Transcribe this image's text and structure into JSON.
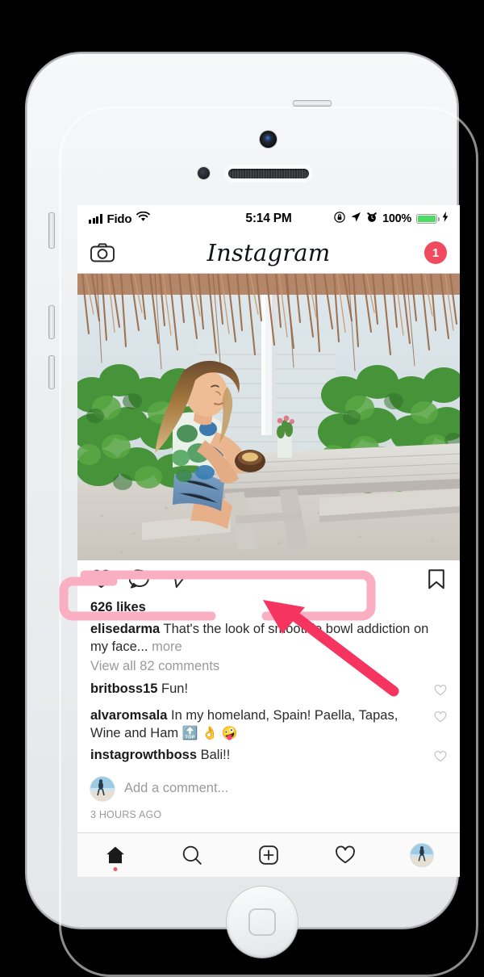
{
  "device": {
    "kind": "iphone-white-silver",
    "hardware": {
      "front_camera": "front-camera",
      "proximity_sensor": "proximity-sensor",
      "earpiece": "earpiece-speaker",
      "home_button": "home-button",
      "mute_switch": "mute-switch",
      "volume_up": "volume-up",
      "volume_down": "volume-down",
      "power_button": "power-button"
    }
  },
  "status_bar": {
    "carrier": "Fido",
    "signal_icon": "signal-bars-icon",
    "wifi_icon": "wifi-icon",
    "time": "5:14 PM",
    "rotation_lock_icon": "rotation-lock-icon",
    "location_icon": "location-arrow-icon",
    "alarm_icon": "alarm-clock-icon",
    "battery_percent": "100%",
    "battery_icon": "battery-full-icon",
    "charging_icon": "lightning-bolt-icon",
    "battery_color": "#4ddc63"
  },
  "header": {
    "camera_icon": "camera-icon",
    "title": "Instagram",
    "notification_count": "1",
    "badge_color": "#f04a5e"
  },
  "post": {
    "photo_alt": "woman-at-picnic-table-with-coconut-bowl",
    "actions": {
      "like_icon": "heart-icon",
      "comment_icon": "comment-bubble-icon",
      "share_icon": "send-paper-plane-icon",
      "save_icon": "bookmark-icon"
    },
    "likes": "626 likes",
    "caption": {
      "username": "elisedarma",
      "text": "That's the look of smoothie bowl addiction on my face...",
      "more_label": "more"
    },
    "view_all_comments": "View all 82 comments",
    "comments": [
      {
        "username": "britboss15",
        "text": "Fun!",
        "emoji": "",
        "like_icon": "heart-outline-icon"
      },
      {
        "username": "alvaromsala",
        "text": "In my homeland, Spain! Paella, Tapas, Wine and Ham",
        "emoji": "🔝 👌 🤪",
        "like_icon": "heart-outline-icon"
      },
      {
        "username": "instagrowthboss",
        "text": "Bali!!",
        "emoji": "",
        "like_icon": "heart-outline-icon"
      }
    ],
    "add_comment_placeholder": "Add a comment...",
    "timestamp": "3 HOURS AGO"
  },
  "bottom_nav": {
    "items": [
      {
        "name": "home",
        "icon": "home-filled-icon",
        "active": true
      },
      {
        "name": "search",
        "icon": "search-magnifier-icon",
        "active": false
      },
      {
        "name": "add-post",
        "icon": "plus-square-icon",
        "active": false
      },
      {
        "name": "activity",
        "icon": "heart-outline-icon",
        "active": false
      },
      {
        "name": "profile",
        "icon": "profile-avatar-icon",
        "active": false
      }
    ],
    "active_dot_color": "#ef5b6b"
  },
  "annotation": {
    "highlight_box_color": "#f9aec2",
    "arrow_color": "#f5355f",
    "target": "caption-more-link"
  }
}
